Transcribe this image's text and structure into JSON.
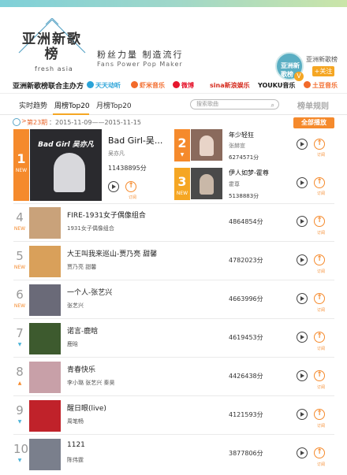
{
  "header": {
    "logo_title": "亚洲新歌榜",
    "logo_sub": "fresh asia",
    "slogan_cn": "粉丝力量  制造流行",
    "slogan_en": "Fans Power    Pop Maker",
    "avatar_text": "亚洲新歌榜",
    "weibo_name": "亚洲新歌榜",
    "follow_label": "+关注",
    "verified_icon": "V"
  },
  "sponsors": {
    "title": "亚洲新歌榜联合主办方",
    "items": [
      {
        "name": "天天动听",
        "color": "#2aa3d8"
      },
      {
        "name": "虾米音乐",
        "color": "#f26a2a"
      },
      {
        "name": "微博",
        "color": "#e6162d"
      },
      {
        "name": "sina新浪娱乐",
        "color": "#d52b1e"
      },
      {
        "name": "YOUKU音乐",
        "color": "#1a1a1a"
      },
      {
        "name": "土豆音乐",
        "color": "#f26a2a"
      }
    ]
  },
  "tabs": {
    "items": [
      "实时趋势",
      "周榜Top20",
      "月榜Top20"
    ],
    "active": "周榜Top20",
    "search_placeholder": "搜索歌曲",
    "rules_label": "榜单规则"
  },
  "period": {
    "issue": "第23期",
    "range": "：2015-11-09——2015-11-15",
    "chevron": ">",
    "play_all": "全部播放"
  },
  "top3": [
    {
      "rank": "1",
      "tag": "NEW",
      "title": "Bad Girl-吴...",
      "artist": "吴亦凡",
      "count": "11438895分",
      "cover_text": "Bad Girl 吴亦凡",
      "cover_color": "#2a2a2e"
    },
    {
      "rank": "2",
      "tag": "▼",
      "title": "年少轻狂",
      "artist": "张赫宣",
      "count": "6274571分",
      "cover_color": "#8a6a5c"
    },
    {
      "rank": "3",
      "tag": "NEW",
      "title": "伊人如梦-霍尊",
      "artist": "霍尊",
      "count": "5138883分",
      "cover_color": "#4a4a4a"
    }
  ],
  "rows": [
    {
      "rank": "4",
      "tag": "NEW",
      "tag_type": "new",
      "title": "FIRE-1931女子偶像组合",
      "artist": "1931女子偶像组合",
      "count": "4864854分",
      "cover_color": "#c9a27a"
    },
    {
      "rank": "5",
      "tag": "NEW",
      "tag_type": "new",
      "title": "大王叫我来巡山-贾乃亮 甜馨",
      "artist": "贾乃亮 甜馨",
      "count": "4782023分",
      "cover_color": "#d9a05a"
    },
    {
      "rank": "6",
      "tag": "NEW",
      "tag_type": "new",
      "title": "一个人-张艺兴",
      "artist": "张艺兴",
      "count": "4663996分",
      "cover_color": "#6a6a78"
    },
    {
      "rank": "7",
      "tag": "▼",
      "tag_type": "down",
      "title": "诺言-鹿晗",
      "artist": "鹿晗",
      "count": "4619453分",
      "cover_color": "#3d5a2e"
    },
    {
      "rank": "8",
      "tag": "▲",
      "tag_type": "up",
      "title": "青春快乐",
      "artist": "李小璐 张艺兴 秦昊",
      "count": "4426438分",
      "cover_color": "#c8a0a8"
    },
    {
      "rank": "9",
      "tag": "▼",
      "tag_type": "down",
      "title": "醒日眼(live)",
      "artist": "周笔畅",
      "count": "4121593分",
      "cover_color": "#c0222a"
    },
    {
      "rank": "10",
      "tag": "▼",
      "tag_type": "down",
      "title": "1121",
      "artist": "陈伟霆",
      "count": "3877806分",
      "cover_color": "#7a7f8c"
    }
  ],
  "labels": {
    "download": "订阅"
  }
}
